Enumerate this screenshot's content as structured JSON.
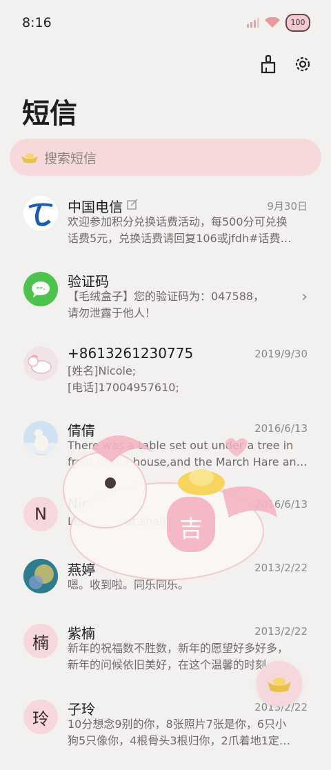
{
  "status_bar": {
    "time": "8:16",
    "battery": "100"
  },
  "page": {
    "title": "短信"
  },
  "search": {
    "placeholder": "搜索短信"
  },
  "conversations": [
    {
      "sender": "中国电信",
      "date": "9月30日",
      "lines": [
        "欢迎参加积分兑换话费活动，每500分可兑换",
        "话费5元，兑换话费请回复106或jfdh#话费…"
      ]
    },
    {
      "sender": "验证码",
      "date": "",
      "lines": [
        "【毛绒盒子】您的验证码为：047588，",
        "请勿泄露于他人！"
      ]
    },
    {
      "sender": "+8613261230775",
      "date": "2019/9/30",
      "lines": [
        "[姓名]Nicole;",
        "[电话]17004957610;"
      ]
    },
    {
      "sender": "倩倩",
      "date": "2016/6/13",
      "lines": [
        "There was a table set out under a tree in",
        "front of the house,and the March Hare an…"
      ]
    },
    {
      "sender": "Nicole",
      "date": "2016/6/13",
      "avatar_letter": "N",
      "lines": [
        "Let's eat out,shall we?"
      ]
    },
    {
      "sender": "燕婷",
      "date": "2013/2/22",
      "lines": [
        "嗯。收到啦。同乐同乐。"
      ]
    },
    {
      "sender": "紫楠",
      "date": "2013/2/22",
      "avatar_letter": "楠",
      "lines": [
        "新年的祝福数不胜数，新年的愿望好多好多，",
        "新年的问候依旧美好，在这个温馨的时刻…"
      ]
    },
    {
      "sender": "子玲",
      "date": "2013/2/22",
      "avatar_letter": "玲",
      "lines": [
        "10分想念9别的你，8张照片7张是你，6只小",
        "狗5只像你，4根骨头3根归你，2爪着地1定…"
      ]
    }
  ],
  "mascot_badge": "吉",
  "colors": {
    "background": "#f3f1ef",
    "search_bg": "#f6dada",
    "accent_pink": "#f6d7dc",
    "telecom_blue": "#1a5bb5",
    "sms_green": "#4cc34c"
  }
}
